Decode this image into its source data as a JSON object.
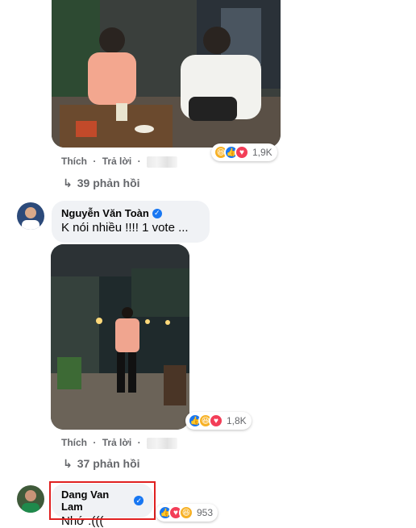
{
  "thread1": {
    "action_like": "Thích",
    "action_reply": "Trả lời",
    "reaction_count": "1,9K",
    "replies_label": "39 phản hồi"
  },
  "comment1": {
    "author": "Nguyễn Văn Toàn",
    "text": "K nói nhiều !!!! 1 vote ...",
    "action_like": "Thích",
    "action_reply": "Trả lời",
    "reaction_count": "1,8K",
    "replies_label": "37 phản hồi"
  },
  "comment2": {
    "author": "Dang Van Lam",
    "text": "Nhớ :(((",
    "reaction_count": "953"
  },
  "icons": {
    "verified": "verified-badge-icon",
    "reply_arrow": "reply-arrow-icon",
    "reactions": [
      "haha",
      "like",
      "love"
    ]
  },
  "colors": {
    "accent": "#1877f2",
    "bubble": "#f0f2f5",
    "secondary_text": "#65676b",
    "highlight": "#e02020"
  }
}
